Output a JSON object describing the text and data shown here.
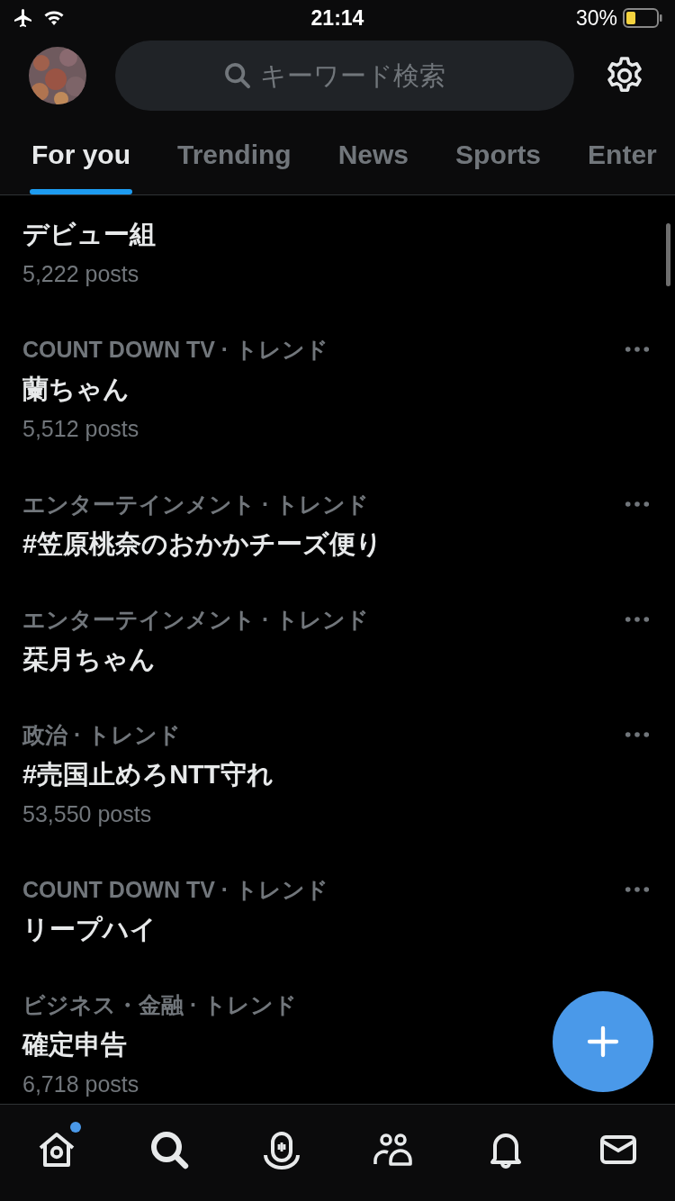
{
  "status_bar": {
    "time": "21:14",
    "battery": "30%"
  },
  "search": {
    "placeholder": "キーワード検索"
  },
  "tabs": [
    {
      "label": "For you",
      "selected": true
    },
    {
      "label": "Trending",
      "selected": false
    },
    {
      "label": "News",
      "selected": false
    },
    {
      "label": "Sports",
      "selected": false
    },
    {
      "label": "Enter",
      "selected": false
    }
  ],
  "trends": [
    {
      "title": "デビュー組",
      "posts": "5,222 posts",
      "menu": false
    },
    {
      "context": "COUNT DOWN TV · トレンド",
      "title": "蘭ちゃん",
      "posts": "5,512 posts",
      "menu": true
    },
    {
      "context": "エンターテインメント · トレンド",
      "title": "#笠原桃奈のおかかチーズ便り",
      "menu": true
    },
    {
      "context": "エンターテインメント · トレンド",
      "title": "栞月ちゃん",
      "menu": true
    },
    {
      "context": "政治 · トレンド",
      "title": "#売国止めろNTT守れ",
      "posts": "53,550 posts",
      "menu": true
    },
    {
      "context": "COUNT DOWN TV · トレンド",
      "title": "リープハイ",
      "menu": true
    },
    {
      "context": "ビジネス・金融 · トレンド",
      "title": "確定申告",
      "posts": "6,718 posts",
      "menu": false
    }
  ],
  "nav": [
    {
      "kind": "home",
      "badge": true
    },
    {
      "kind": "search",
      "badge": false
    },
    {
      "kind": "spaces",
      "badge": false
    },
    {
      "kind": "communities",
      "badge": false
    },
    {
      "kind": "notifications",
      "badge": false
    },
    {
      "kind": "messages",
      "badge": false
    }
  ]
}
